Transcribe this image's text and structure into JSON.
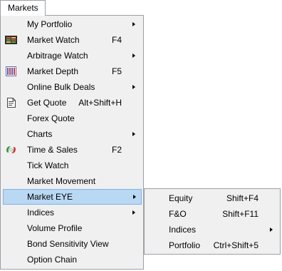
{
  "menubar": {
    "title": "Markets"
  },
  "menu": {
    "items": [
      {
        "label": "My Portfolio",
        "shortcut": "",
        "submenu": true,
        "icon": ""
      },
      {
        "label": "Market Watch",
        "shortcut": "F4",
        "submenu": false,
        "icon": "market-watch-icon"
      },
      {
        "label": "Arbitrage Watch",
        "shortcut": "",
        "submenu": true,
        "icon": ""
      },
      {
        "label": "Market Depth",
        "shortcut": "F5",
        "submenu": false,
        "icon": "market-depth-icon"
      },
      {
        "label": "Online Bulk Deals",
        "shortcut": "",
        "submenu": true,
        "icon": ""
      },
      {
        "label": "Get Quote",
        "shortcut": "Alt+Shift+H",
        "submenu": false,
        "icon": "get-quote-icon"
      },
      {
        "label": "Forex Quote",
        "shortcut": "",
        "submenu": false,
        "icon": ""
      },
      {
        "label": "Charts",
        "shortcut": "",
        "submenu": true,
        "icon": ""
      },
      {
        "label": "Time & Sales",
        "shortcut": "F2",
        "submenu": false,
        "icon": "time-sales-icon"
      },
      {
        "label": "Tick Watch",
        "shortcut": "",
        "submenu": false,
        "icon": ""
      },
      {
        "label": "Market Movement",
        "shortcut": "",
        "submenu": false,
        "icon": ""
      },
      {
        "label": "Market EYE",
        "shortcut": "",
        "submenu": true,
        "icon": ""
      },
      {
        "label": "Indices",
        "shortcut": "",
        "submenu": true,
        "icon": ""
      },
      {
        "label": "Volume Profile",
        "shortcut": "",
        "submenu": false,
        "icon": ""
      },
      {
        "label": "Bond Sensitivity View",
        "shortcut": "",
        "submenu": false,
        "icon": ""
      },
      {
        "label": "Option Chain",
        "shortcut": "",
        "submenu": false,
        "icon": ""
      }
    ]
  },
  "submenu": {
    "items": [
      {
        "label": "Equity",
        "shortcut": "Shift+F4",
        "submenu": false
      },
      {
        "label": "F&O",
        "shortcut": "Shift+F11",
        "submenu": false
      },
      {
        "label": "Indices",
        "shortcut": "",
        "submenu": true
      },
      {
        "label": "Portfolio",
        "shortcut": "Ctrl+Shift+5",
        "submenu": false
      }
    ]
  },
  "colors": {
    "highlight": "#b9d8f3",
    "highlight_border": "#7fb3e3",
    "menu_background": "#f0f0f0"
  }
}
